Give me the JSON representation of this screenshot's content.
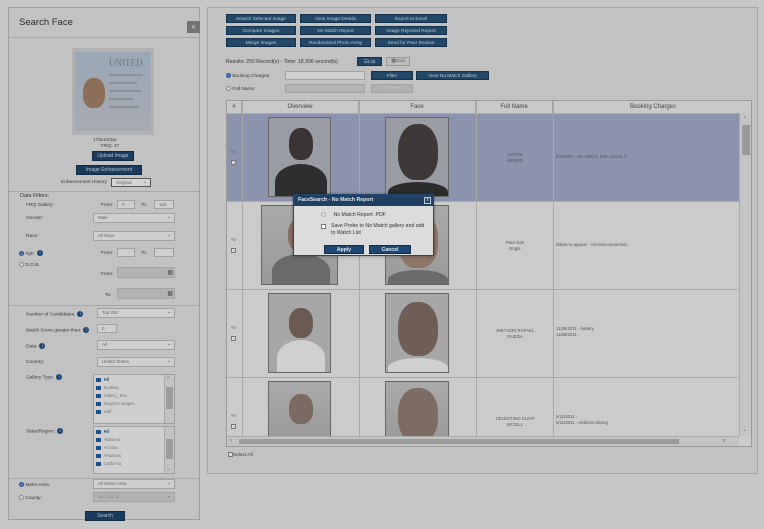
{
  "left_panel": {
    "title": "Search Face",
    "collapse_label": "«",
    "id_card_title": "UNITED",
    "image_size": "175x197px",
    "frq": "FRQ: 47",
    "upload_label": "Upload Image",
    "enhancement_label": "Image Enhancement",
    "enhancement_history_label": "Enhancement History",
    "enhancement_history_value": "Original",
    "filters_heading": "Data Filters:",
    "frq_gallery_label": "FRQ Gallery:",
    "from_label": "From:",
    "to_label": "To:",
    "frq_from": "0",
    "frq_to": "100",
    "gender_label": "Gender:",
    "gender_value": "Male",
    "race_label": "Race:",
    "race_value": "All Race",
    "age_label": "Age:",
    "dob_label": "D.O.B.",
    "candidates_label": "Number of Candidates:",
    "candidates_value": "Top 250",
    "match_score_label": "Match Score greater than:",
    "match_score_value": "0",
    "data_label": "Data:",
    "data_value": "All",
    "country_label": "Country:",
    "country_value": "United States",
    "gallery_type_label": "Gallery Type:",
    "gallery_items": [
      "All",
      "Booking",
      "Gallery_Test",
      "Mugshot Images",
      "staff"
    ],
    "state_label": "State/Region:",
    "state_items": [
      "All",
      "Alabama",
      "Arizona",
      "Arkansas",
      "California"
    ],
    "metro_label": "Metro Area:",
    "metro_value": "All Metro Area",
    "county_label": "County:",
    "county_value": "No County",
    "search_label": "Search"
  },
  "toolbar": {
    "buttons": [
      "Search Selected Image",
      "View Image Details",
      "Export to Excel",
      "Compare Images",
      "No Match Report",
      "Image Rejected Report",
      "Merge Images",
      "Randomized Photo Array",
      "Send for Peer Review"
    ]
  },
  "results": {
    "summary": "Results: 250 Record(s) - Time: 18.306 second(s)",
    "list_label": "List",
    "grid_label": "Grid",
    "booking_label": "Booking Charges:",
    "fullname_label": "Full Name:",
    "filter_label": "Filter",
    "view_no_match_label": "View No Match Gallery",
    "clear_label": "Clear",
    "select_all_label": "Select All",
    "columns": [
      "#",
      "Overview",
      "Face",
      "Full Name",
      "Booking Charges"
    ],
    "rows": [
      {
        "num": "#1",
        "name": "DANTE\nHEWER",
        "charges": "8/9/2007 - site 1000 ft. from school, 0",
        "selected": true
      },
      {
        "num": "#2",
        "name": "Paul Alan\nEngle",
        "charges": "failure to appear - criminal conversion",
        "selected": false
      },
      {
        "num": "#3",
        "name": "JHEYSON RAFAEL\nRUEDA",
        "charges": "11/28/2011 - battery\n11/28/2011 -",
        "selected": false
      },
      {
        "num": "#4",
        "name": "CELESTINO CLINT\nMCGILL",
        "charges": "5/11/2011 -\n5/11/2011 - reckless driving",
        "selected": false
      }
    ]
  },
  "modal": {
    "title": "FaceSearch - No Match Report",
    "close": "x",
    "option1": "No Match Report .PDF",
    "option2": "Save Probe to No Match gallery and add to Watch List",
    "apply": "Apply",
    "cancel": "Cancel"
  }
}
